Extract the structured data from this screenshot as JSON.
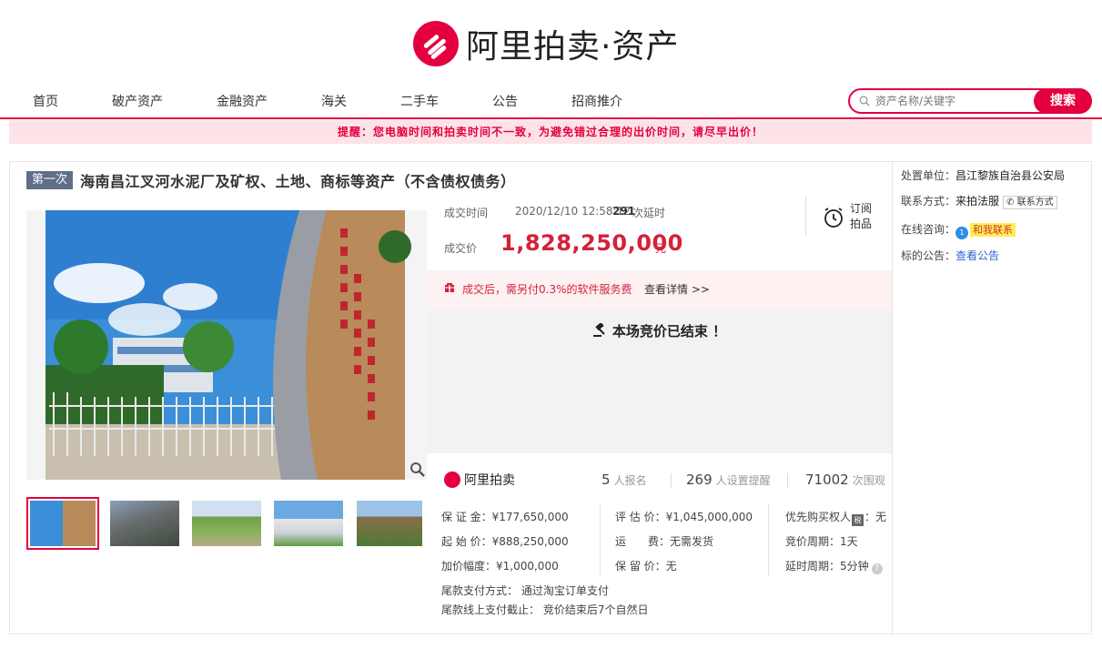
{
  "brand": {
    "name": "阿里拍卖·资产",
    "mini_name": "阿里拍卖",
    "accent_color": "#e4003f",
    "price_color": "#d4213a"
  },
  "nav": {
    "items": [
      "首页",
      "破产资产",
      "金融资产",
      "海关",
      "二手车",
      "公告",
      "招商推介"
    ]
  },
  "search": {
    "placeholder": "资产名称/关键字",
    "button_label": "搜索"
  },
  "warning": "提醒：您电脑时间和拍卖时间不一致，为避免错过合理的出价时间，请尽早出价！",
  "lot": {
    "round_badge": "第一次",
    "title": "海南昌江叉河水泥厂及矿权、土地、商标等资产（不含债权债务）",
    "deal_time_label": "成交时间",
    "deal_time": "2020/12/10 12:58:12",
    "delay_count": "291",
    "delay_label": "次延时",
    "deal_price_label": "成交价",
    "deal_price": "1,828,250,000",
    "deal_unit": "元",
    "subscribe_label": "订阅拍品",
    "fee_text": "成交后，需另付0.3%的软件服务费",
    "fee_link": "查看详情 >>",
    "ended_text": "本场竞价已结束 ！"
  },
  "stats": {
    "signups": "5",
    "signups_label": "人报名",
    "reminders": "269",
    "reminders_label": "人设置提醒",
    "views": "71002",
    "views_label": "次围观"
  },
  "info": {
    "deposit": "保 证 金：¥177,650,000",
    "start_price": "起 始 价：¥888,250,000",
    "increment": "加价幅度：¥1,000,000",
    "appraisal": "评 估 价：¥1,045,000,000",
    "shipping": "运　　费：无需发货",
    "reserve": "保 留 价：无",
    "priority_prefix": "优先购买权人",
    "priority_badge": "税",
    "priority_suffix": "：无",
    "cycle": "竞价周期：1天",
    "delay_cycle": "延时周期：5分钟",
    "help_glyph": "?",
    "balance_method": "尾款支付方式： 通过淘宝订单支付",
    "balance_deadline": "尾款线上支付截止： 竞价结束后7个自然日"
  },
  "sidebar": {
    "unit_label": "处置单位：",
    "unit": "昌江黎族自治县公安局",
    "contact_label": "联系方式：",
    "contact": "来拍法服",
    "contact_chip": "联系方式",
    "chat_label": "在线咨询：",
    "chat_dot": "1",
    "chat_chip": "和我联系",
    "notice_label": "标的公告：",
    "notice_link": "查看公告"
  }
}
